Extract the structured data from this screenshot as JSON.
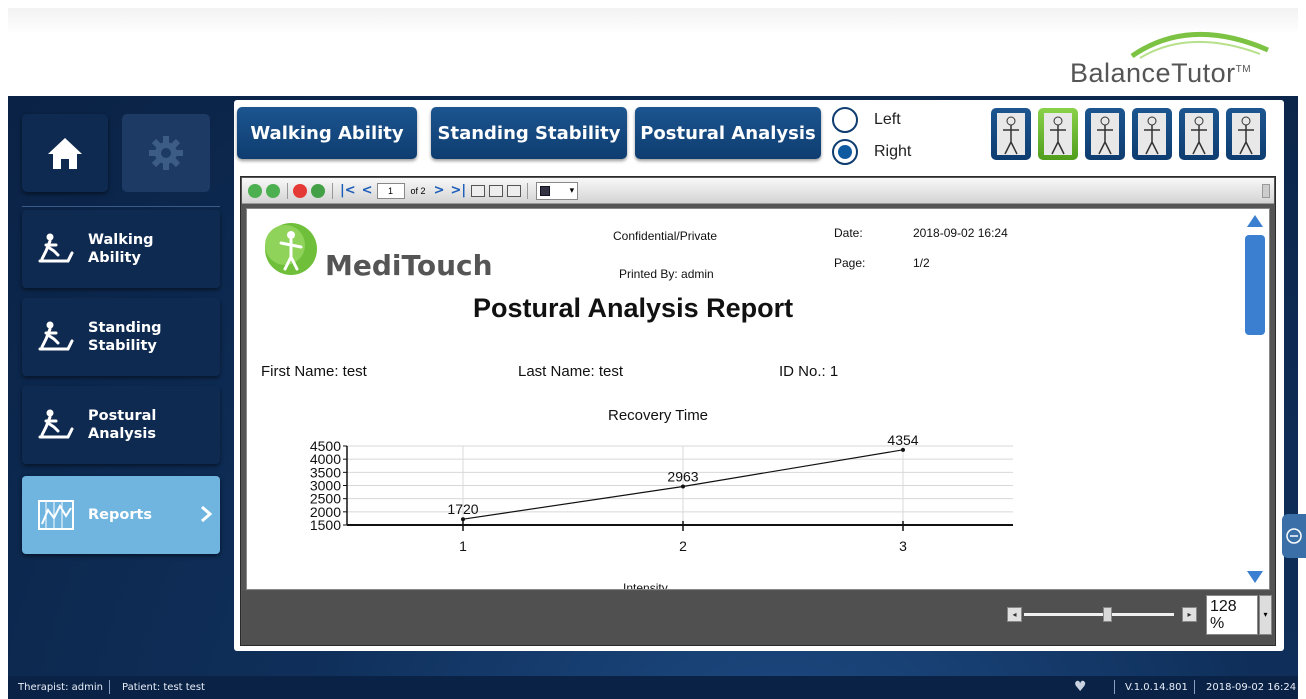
{
  "app": {
    "brand": "BalanceTutor",
    "trademark": "TM"
  },
  "sidebar": {
    "items": [
      {
        "label": "Walking\nAbility",
        "icon": "treadmill-icon"
      },
      {
        "label": "Standing\nStability",
        "icon": "treadmill-icon"
      },
      {
        "label": "Postural\nAnalysis",
        "icon": "treadmill-icon"
      },
      {
        "label": "Reports",
        "icon": "chart-icon",
        "active": true
      }
    ]
  },
  "tabs": {
    "walking": "Walking Ability",
    "standing": "Standing Stability",
    "postural": "Postural Analysis"
  },
  "side_select": {
    "left": "Left",
    "right": "Right",
    "selected": "Right"
  },
  "viewer": {
    "page_input": "1",
    "page_of": "of 2",
    "zoom_value": "128\n%",
    "zoom_level": 0.55
  },
  "report": {
    "company": "MediTouch",
    "confidential": "Confidential/Private",
    "printed_by": "Printed By: admin",
    "date_label": "Date:",
    "date_value": "2018-09-02 16:24",
    "page_label": "Page:",
    "page_value": "1/2",
    "title": "Postural Analysis Report",
    "first_name": "First Name:  test",
    "last_name": "Last Name:  test",
    "id_no": "ID No.:  1",
    "next_section": "Intensity"
  },
  "chart_data": {
    "type": "line",
    "title": "Recovery Time",
    "x": [
      1,
      2,
      3
    ],
    "values": [
      1720,
      2963,
      4354
    ],
    "data_labels": [
      "1720",
      "2963",
      "4354"
    ],
    "ylim": [
      1500,
      4500
    ],
    "yticks": [
      1500,
      2000,
      2500,
      3000,
      3500,
      4000,
      4500
    ],
    "xticks": [
      "1",
      "2",
      "3"
    ],
    "grid": true
  },
  "status": {
    "therapist": "Therapist: admin",
    "patient": "Patient: test test",
    "version": "V.1.0.14.801",
    "datetime": "2018-09-02 16:24"
  },
  "colors": {
    "navy": "#0f2a50",
    "button_blue": "#0e3d70",
    "active_blue": "#6fb5e0",
    "accent_green": "#6fbf3a"
  }
}
